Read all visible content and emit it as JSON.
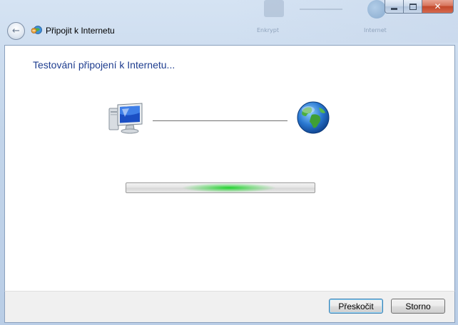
{
  "window": {
    "title": "Připojit k Internetu",
    "background_labels": [
      "Enkrypt",
      "Internet"
    ]
  },
  "caption_buttons": {
    "minimize_icon": "minimize-icon",
    "maximize_icon": "maximize-icon",
    "close_icon": "close-icon",
    "close_glyph": "✕"
  },
  "nav": {
    "back_icon": "back-arrow-icon",
    "back_glyph": "←"
  },
  "main": {
    "heading": "Testování připojení k Internetu...",
    "left_icon": "computer-icon",
    "right_icon": "globe-icon",
    "progress": {
      "state": "indeterminate",
      "color": "#16d224"
    }
  },
  "footer": {
    "skip_label": "Přeskočit",
    "cancel_label": "Storno"
  },
  "colors": {
    "heading": "#1e3d8f",
    "frame": "#c3d5ea",
    "close_button": "#c2472a"
  }
}
